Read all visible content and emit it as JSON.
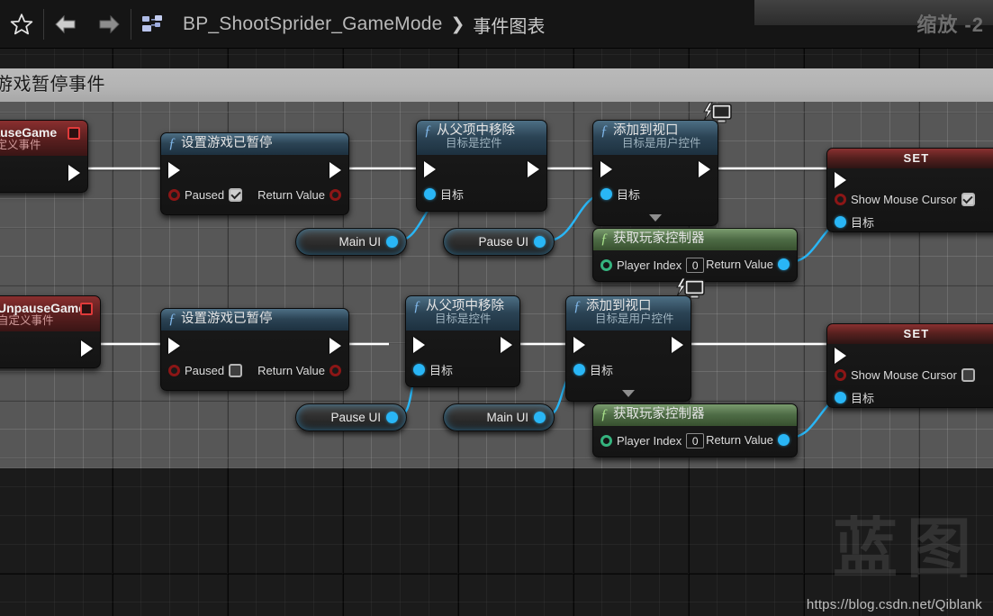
{
  "toolbar": {
    "favorite_icon": "star-icon",
    "back_icon": "back-arrow-icon",
    "forward_icon": "forward-arrow-icon",
    "blueprint_icon": "blueprint-icon",
    "breadcrumb_root": "BP_ShootSprider_GameMode",
    "breadcrumb_separator": "❯",
    "breadcrumb_current": "事件图表",
    "zoom_label": "缩放 -2"
  },
  "comment_region": {
    "title": "游戏暂停事件",
    "color": "#7d7d7d"
  },
  "nodes": {
    "pause_event": {
      "title": "PauseGame",
      "subtitle": "自定义事件",
      "out_exec": "",
      "stop_icon": "stop-square-icon"
    },
    "unpause_event": {
      "title": "UnpauseGame",
      "subtitle": "自定义事件",
      "out_exec": "",
      "stop_icon": "stop-square-icon"
    },
    "set_game_paused_1": {
      "title": "设置游戏已暂停",
      "input_label": "Paused",
      "input_checked": true,
      "output_label": "Return Value"
    },
    "set_game_paused_2": {
      "title": "设置游戏已暂停",
      "input_label": "Paused",
      "input_checked": false,
      "output_label": "Return Value"
    },
    "remove_from_parent_1": {
      "title": "从父项中移除",
      "subtitle": "目标是控件",
      "target_label": "目标"
    },
    "remove_from_parent_2": {
      "title": "从父项中移除",
      "subtitle": "目标是控件",
      "target_label": "目标"
    },
    "add_to_viewport_1": {
      "title": "添加到视口",
      "subtitle": "目标是用户控件",
      "target_label": "目标",
      "badge_icon": "client-monitor-icon",
      "expand_icon": "chevron-down-icon"
    },
    "add_to_viewport_2": {
      "title": "添加到视口",
      "subtitle": "目标是用户控件",
      "target_label": "目标",
      "badge_icon": "client-monitor-icon",
      "expand_icon": "chevron-down-icon"
    },
    "get_player_controller_1": {
      "title": "获取玩家控制器",
      "input_label": "Player Index",
      "input_value": "0",
      "output_label": "Return Value"
    },
    "get_player_controller_2": {
      "title": "获取玩家控制器",
      "input_label": "Player Index",
      "input_value": "0",
      "output_label": "Return Value"
    },
    "set_show_mouse_cursor_1": {
      "title": "SET",
      "property_label": "Show Mouse Cursor",
      "property_checked": true,
      "target_label": "目标"
    },
    "set_show_mouse_cursor_2": {
      "title": "SET",
      "property_label": "Show Mouse Cursor",
      "property_checked": false,
      "target_label": "目标"
    },
    "var_main_ui_1": {
      "label": "Main UI"
    },
    "var_pause_ui_1": {
      "label": "Pause UI"
    },
    "var_pause_ui_2": {
      "label": "Pause UI"
    },
    "var_main_ui_2": {
      "label": "Main UI"
    }
  },
  "watermark": {
    "text": "蓝图",
    "url": "https://blog.csdn.net/Qiblank"
  },
  "colors": {
    "exec_wire": "#ffffff",
    "object_wire": "#29b6f6",
    "bool_pin": "#8c1616",
    "event_header": "#5d2020",
    "function_header": "#2b4354",
    "pure_header": "#4e6c46"
  }
}
